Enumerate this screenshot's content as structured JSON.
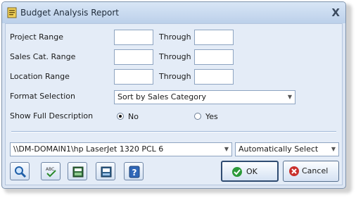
{
  "window": {
    "title": "Budget Analysis Report",
    "close_label": "X"
  },
  "ranges": [
    {
      "label": "Project Range",
      "from": "",
      "through_label": "Through",
      "to": ""
    },
    {
      "label": "Sales Cat. Range",
      "from": "",
      "through_label": "Through",
      "to": ""
    },
    {
      "label": "Location Range",
      "from": "",
      "through_label": "Through",
      "to": ""
    }
  ],
  "format": {
    "label": "Format Selection",
    "value": "Sort by Sales Category"
  },
  "description": {
    "label": "Show Full Description",
    "no_label": "No",
    "yes_label": "Yes",
    "selected": "No"
  },
  "printer": {
    "value": "\\\\DM-DOMAIN1\\hp LaserJet 1320 PCL 6",
    "tray": "Automatically Select"
  },
  "toolbar": {
    "icons": [
      "magnifier-icon",
      "spellcheck-icon",
      "print-preview-icon",
      "export-icon",
      "help-icon"
    ]
  },
  "buttons": {
    "ok": "OK",
    "cancel": "Cancel"
  }
}
